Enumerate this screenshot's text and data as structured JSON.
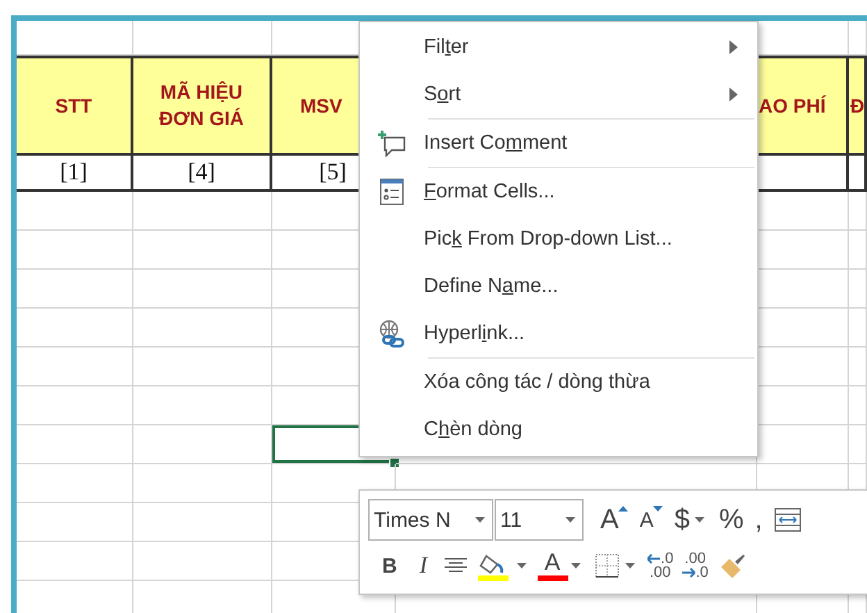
{
  "sheet": {
    "columns": [
      {
        "header": "STT",
        "index_label": "[1]"
      },
      {
        "header": "MÃ HIỆU\nĐƠN GIÁ",
        "index_label": "[4]"
      },
      {
        "header": "MSV",
        "index_label": "[5]"
      },
      {},
      {
        "header": "AO PHÍ"
      },
      {
        "header": "Đ"
      }
    ],
    "body_rows": [
      {
        "cells": [
          {
            "selected": false
          },
          {
            "selected": false
          },
          {
            "selected": false
          },
          {},
          {
            "selected": false
          },
          {
            "selected": false
          }
        ]
      },
      {
        "cells": [
          {
            "selected": false
          },
          {
            "selected": false
          },
          {
            "selected": false
          },
          {},
          {
            "selected": false
          },
          {
            "selected": false
          }
        ]
      },
      {
        "cells": [
          {
            "selected": false
          },
          {
            "selected": false
          },
          {
            "selected": false
          },
          {},
          {
            "selected": false
          },
          {
            "selected": false
          }
        ]
      },
      {
        "cells": [
          {
            "selected": false
          },
          {
            "selected": false
          },
          {
            "selected": false
          },
          {},
          {
            "selected": false
          },
          {
            "selected": false
          }
        ]
      },
      {
        "cells": [
          {
            "selected": false
          },
          {
            "selected": false
          },
          {
            "selected": false
          },
          {},
          {
            "selected": false
          },
          {
            "selected": false
          }
        ]
      },
      {
        "cells": [
          {
            "selected": false
          },
          {
            "selected": false
          },
          {
            "selected": false
          },
          {},
          {
            "selected": false
          },
          {
            "selected": false
          }
        ]
      },
      {
        "cells": [
          {
            "selected": false
          },
          {
            "selected": false
          },
          {
            "selected": true
          },
          {
            "selected": false
          },
          {
            "selected": false
          },
          {
            "selected": false
          }
        ]
      },
      {
        "cells": [
          {
            "selected": false
          },
          {
            "selected": false
          },
          {
            "selected": false
          },
          {
            "selected": false
          },
          {
            "selected": false
          },
          {
            "selected": false
          }
        ]
      },
      {
        "cells": [
          {
            "selected": false
          },
          {
            "selected": false
          },
          {
            "selected": false
          },
          {},
          {},
          {}
        ]
      },
      {
        "cells": [
          {
            "selected": false
          },
          {
            "selected": false
          },
          {
            "selected": false
          },
          {},
          {},
          {}
        ]
      },
      {
        "cells": [
          {
            "selected": false
          },
          {
            "selected": false
          },
          {
            "selected": false
          },
          {},
          {},
          {}
        ]
      }
    ]
  },
  "context_menu": {
    "items": [
      {
        "kind": "submenu",
        "label": {
          "before": "Fil",
          "key": "t",
          "after": "er"
        },
        "separator_before": false
      },
      {
        "kind": "submenu",
        "label": {
          "before": "S",
          "key": "o",
          "after": "rt"
        },
        "separator_before": false
      },
      {
        "kind": "comment",
        "label": {
          "before": "Insert Co",
          "key": "m",
          "after": "ment"
        },
        "separator_before": true
      },
      {
        "kind": "format",
        "label": {
          "key": "F",
          "after": "ormat Cells..."
        },
        "separator_before": true
      },
      {
        "kind": "plain",
        "label": {
          "before": "Pic",
          "key": "k",
          "after": " From Drop-down List..."
        },
        "separator_before": false
      },
      {
        "kind": "plain",
        "label": {
          "before": "Define N",
          "key": "a",
          "after": "me..."
        },
        "separator_before": false
      },
      {
        "kind": "link",
        "label": {
          "before": "Hyperl",
          "key": "i",
          "after": "nk..."
        },
        "separator_before": false
      },
      {
        "kind": "plain",
        "label": {
          "before": "Xóa công tác / dòng thừa"
        },
        "separator_before": true
      },
      {
        "kind": "plain",
        "label": {
          "before": "C",
          "key": "h",
          "after": "èn dòng"
        },
        "separator_before": false
      }
    ]
  },
  "mini_toolbar": {
    "upper_controls": [
      {
        "kind": "font",
        "value": "Times N"
      },
      {
        "kind": "size",
        "value": "11"
      },
      {
        "kind": "grow",
        "text": "A"
      },
      {
        "kind": "shrink",
        "text": "A"
      },
      {
        "kind": "char",
        "text": "$",
        "dropdown": true
      },
      {
        "kind": "char",
        "text": "%",
        "dropdown": false
      },
      {
        "kind": "char",
        "text": ",",
        "dropdown": false
      },
      {
        "kind": "wrap"
      }
    ],
    "lower_controls": [
      {
        "kind": "bold",
        "text": "B"
      },
      {
        "kind": "italic",
        "text": "I"
      },
      {
        "kind": "align"
      },
      {
        "kind": "fill",
        "color": "#ffff00"
      },
      {
        "kind": "fontcolor",
        "text": "A",
        "color": "#ff0000"
      },
      {
        "kind": "borders"
      },
      {
        "kind": "decimal-add",
        "top": ".0",
        "bottom": ".00"
      },
      {
        "kind": "decimal-remove",
        "top": ".00",
        "bottom": ".0"
      },
      {
        "kind": "painter"
      }
    ]
  }
}
